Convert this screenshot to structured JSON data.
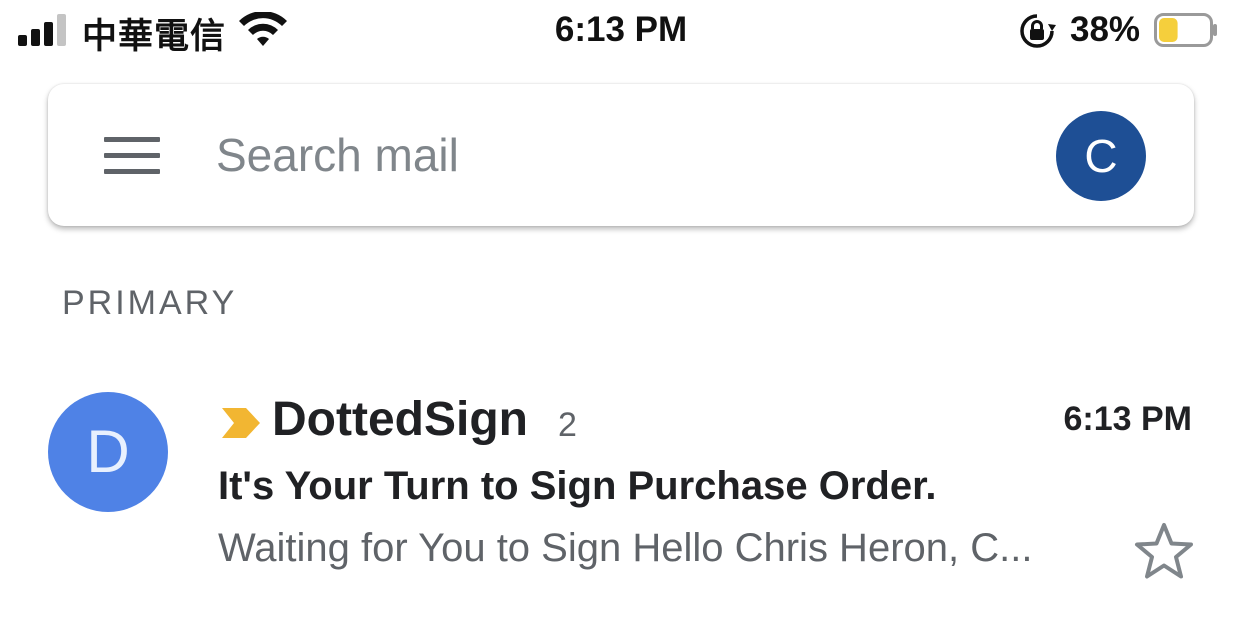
{
  "status_bar": {
    "carrier": "中華電信",
    "time": "6:13 PM",
    "battery_percent": "38%",
    "battery_level": 0.38,
    "battery_color": "#f5cf3c",
    "icons": [
      "cellular-signal-icon",
      "wifi-icon",
      "orientation-lock-icon",
      "battery-icon"
    ]
  },
  "search": {
    "placeholder": "Search mail",
    "menu_icon": "hamburger-menu-icon",
    "account_initial": "C",
    "account_color": "#1e4f95"
  },
  "inbox": {
    "section_label": "PRIMARY",
    "emails": [
      {
        "avatar_initial": "D",
        "avatar_color": "#4f82e6",
        "importance_marker": "important-marker-icon",
        "importance_color": "#f2b632",
        "sender": "DottedSign",
        "thread_count": "2",
        "time": "6:13 PM",
        "subject": "It's Your Turn to Sign Purchase Order.",
        "snippet": "Waiting for You to Sign Hello Chris Heron, C...",
        "starred": false
      }
    ]
  }
}
